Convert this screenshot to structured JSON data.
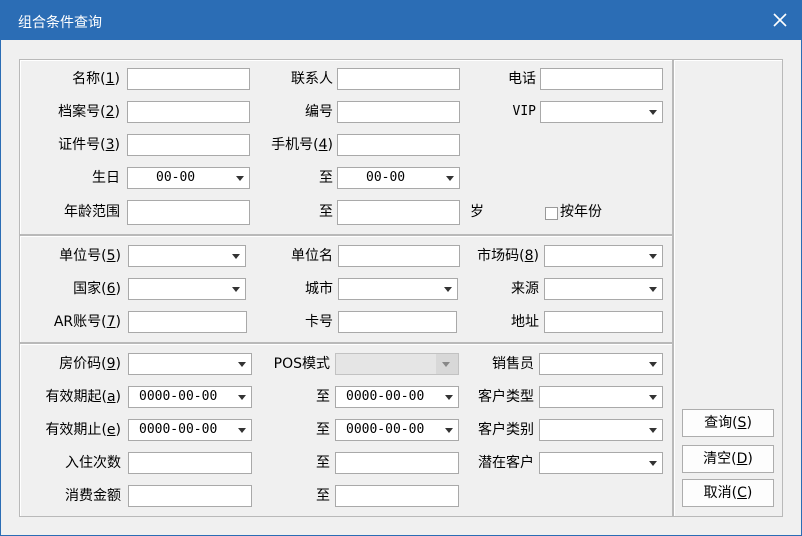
{
  "window": {
    "title": "组合条件查询"
  },
  "group1": {
    "name_label": "名称",
    "name_key": "1",
    "contact_label": "联系人",
    "phone_label": "电话",
    "archive_label": "档案号",
    "archive_key": "2",
    "code_label": "编号",
    "vip_label": "VIP",
    "idcard_label": "证件号",
    "idcard_key": "3",
    "mobile_label": "手机号",
    "mobile_key": "4",
    "birthday_label": "生日",
    "birthday_from": "00-00",
    "to_label": "至",
    "birthday_to": "00-00",
    "age_label": "年龄范围",
    "age_unit": "岁",
    "by_year_label": "按年份"
  },
  "group2": {
    "unit_no_label": "单位号",
    "unit_no_key": "5",
    "unit_name_label": "单位名",
    "market_label": "市场码",
    "market_key": "8",
    "country_label": "国家",
    "country_key": "6",
    "city_label": "城市",
    "source_label": "来源",
    "ar_label": "AR账号",
    "ar_key": "7",
    "card_label": "卡号",
    "address_label": "地址"
  },
  "group3": {
    "rate_label": "房价码",
    "rate_key": "9",
    "pos_label": "POS模式",
    "sales_label": "销售员",
    "valid_from_label": "有效期起",
    "valid_from_key": "a",
    "valid_from_value": "0000-00-00",
    "valid_from_to_value": "0000-00-00",
    "guest_type_label": "客户类型",
    "valid_to_label": "有效期止",
    "valid_to_key": "e",
    "valid_to_value": "0000-00-00",
    "valid_to_to_value": "0000-00-00",
    "guest_cat_label": "客户类别",
    "stays_label": "入住次数",
    "potential_label": "潜在客户",
    "spend_label": "消费金额",
    "to_label": "至"
  },
  "buttons": {
    "query": "查询",
    "query_key": "S",
    "clear": "清空",
    "clear_key": "D",
    "cancel": "取消",
    "cancel_key": "C"
  }
}
